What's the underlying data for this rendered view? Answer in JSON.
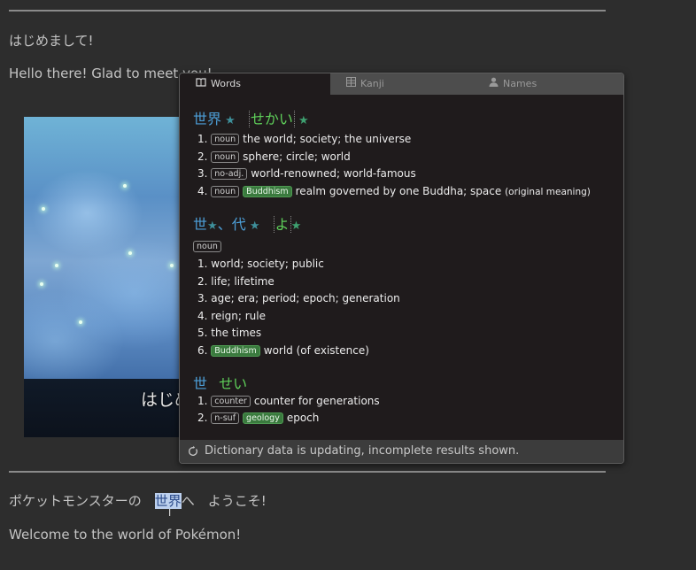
{
  "page": {
    "line1": "はじめまして!",
    "line2": "Hello there! Glad to meet you!",
    "line3_pre": "ポケットモンスターの　",
    "line3_hl": "世界",
    "line3_post": "へ　ようこそ!",
    "line4": "Welcome to the world of Pokémon!"
  },
  "video": {
    "subtitle": "はじめ"
  },
  "popup": {
    "tabs": [
      {
        "label": "Words",
        "icon": "book-icon",
        "active": true
      },
      {
        "label": "Kanji",
        "icon": "kanji-icon",
        "active": false
      },
      {
        "label": "Names",
        "icon": "person-icon",
        "active": false
      }
    ],
    "entries": [
      {
        "kanji": [
          "世界"
        ],
        "reading": "せかい",
        "senses": [
          {
            "num": "1.",
            "tags": [
              "noun"
            ],
            "gloss": "the world; society; the universe"
          },
          {
            "num": "2.",
            "tags": [
              "noun"
            ],
            "gloss": "sphere; circle; world"
          },
          {
            "num": "3.",
            "tags": [
              "no-adj."
            ],
            "gloss": "world-renowned; world-famous"
          },
          {
            "num": "4.",
            "tags": [
              "noun",
              "Buddhism"
            ],
            "gloss": "realm governed by one Buddha; space",
            "note": "(original meaning)"
          }
        ]
      },
      {
        "kanji": [
          "世",
          "代"
        ],
        "separator": "、",
        "reading": "よ",
        "pos": "noun",
        "senses": [
          {
            "num": "1.",
            "gloss": "world; society; public"
          },
          {
            "num": "2.",
            "gloss": "life; lifetime"
          },
          {
            "num": "3.",
            "gloss": "age; era; period; epoch; generation"
          },
          {
            "num": "4.",
            "gloss": "reign; rule"
          },
          {
            "num": "5.",
            "gloss": "the times"
          },
          {
            "num": "6.",
            "tags": [
              "Buddhism"
            ],
            "gloss": "world (of existence)"
          }
        ]
      },
      {
        "kanji": [
          "世"
        ],
        "reading": "せい",
        "senses": [
          {
            "num": "1.",
            "tags": [
              "counter"
            ],
            "gloss": "counter for generations"
          },
          {
            "num": "2.",
            "tags": [
              "n-suf",
              "geology"
            ],
            "gloss": "epoch"
          }
        ]
      }
    ],
    "status": "Dictionary data is updating, incomplete results shown.",
    "status_icon": "refresh-icon"
  },
  "colors": {
    "background": "#2d2d2d",
    "popup_bg": "#1f1b1c",
    "kanji": "#4d9fd8",
    "reading": "#5fd05a",
    "green_tag": "#3a7a3e",
    "highlight": "#bcd0ee"
  }
}
